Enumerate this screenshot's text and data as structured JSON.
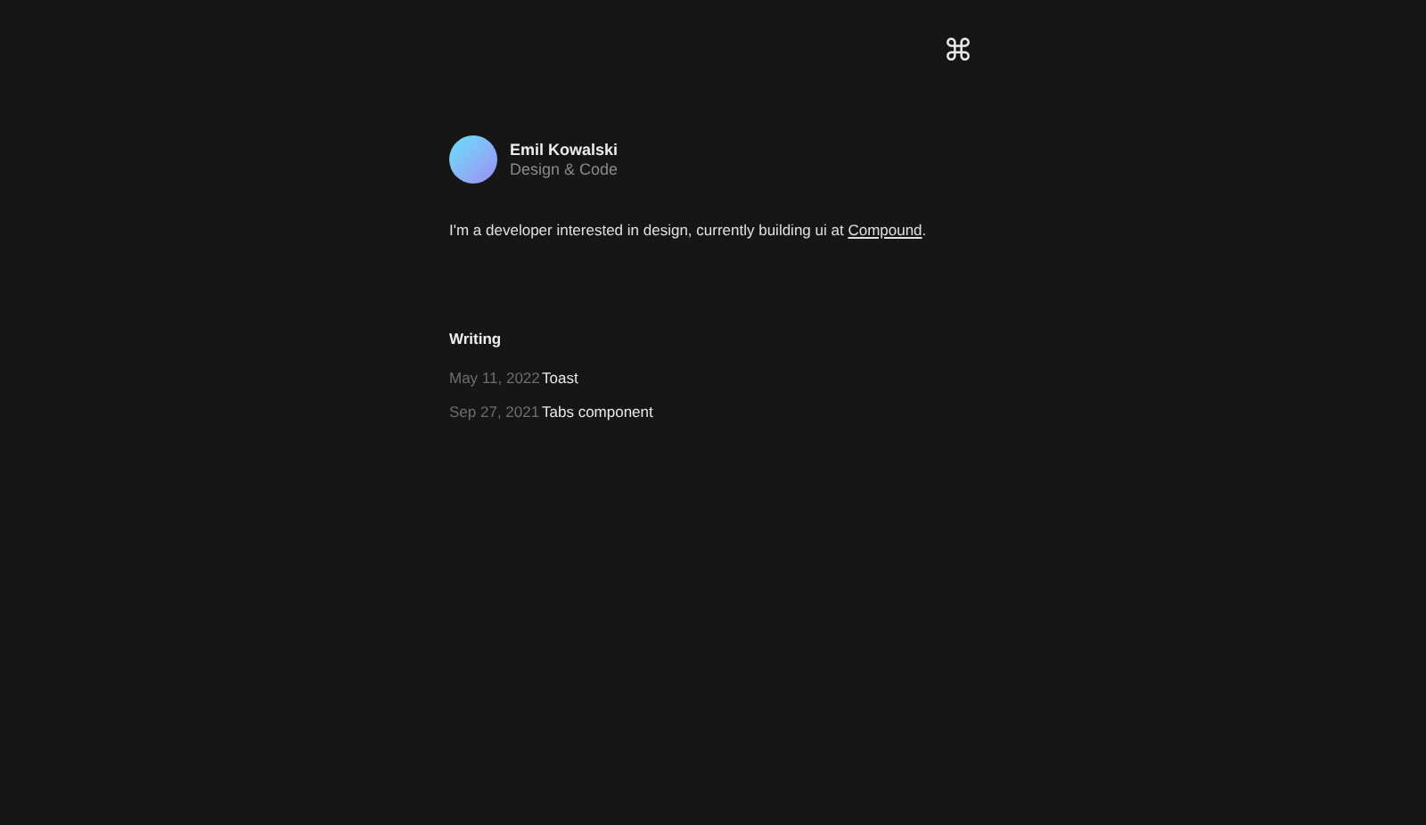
{
  "command_key": "⌘",
  "profile": {
    "name": "Emil Kowalski",
    "tagline": "Design & Code"
  },
  "bio": {
    "text": "I'm a developer interested in design, currently building ui at ",
    "link": "Compound",
    "after": "."
  },
  "writing": {
    "heading": "Writing",
    "posts": [
      {
        "date": "May 11, 2022",
        "title": "Toast"
      },
      {
        "date": "Sep 27, 2021",
        "title": "Tabs component"
      }
    ]
  }
}
